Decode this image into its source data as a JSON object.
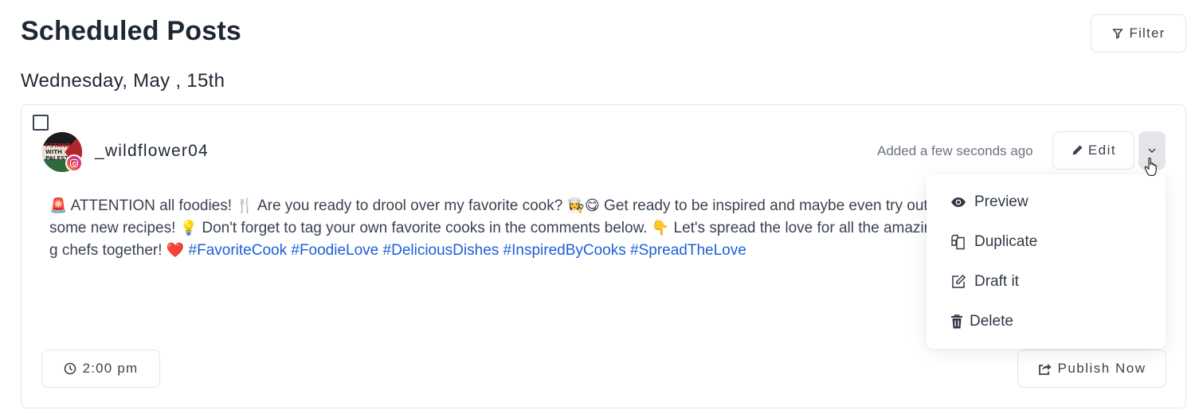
{
  "header": {
    "title": "Scheduled Posts",
    "filter_label": "Filter",
    "filter_icon": "filter-icon"
  },
  "date_heading": "Wednesday, May , 15th",
  "post": {
    "selected": false,
    "account": {
      "username": "_wildflower04",
      "avatar_text": [
        "I STAND",
        "WITH",
        "PALEST"
      ],
      "platform": "instagram",
      "platform_icon": "instagram-icon"
    },
    "added_text": "Added a few seconds ago",
    "edit_label": "Edit",
    "edit_icon": "pencil-icon",
    "more_icon": "chevron-down-icon",
    "content": {
      "segments": [
        {
          "type": "emoji",
          "text": "🚨",
          "name": "siren-emoji"
        },
        {
          "type": "text",
          "text": " ATTENTION all foodies! "
        },
        {
          "type": "emoji",
          "text": "🍴",
          "name": "fork-knife-emoji"
        },
        {
          "type": "text",
          "text": " Are you ready to drool over my favorite cook? "
        },
        {
          "type": "emoji",
          "text": "👩‍🍳",
          "name": "woman-cook-emoji"
        },
        {
          "type": "emoji",
          "text": "😋",
          "name": "yum-face-emoji"
        },
        {
          "type": "text",
          "text": " Get ready to be inspired and maybe even try out some new recipes! "
        },
        {
          "type": "emoji",
          "text": "💡",
          "name": "light-bulb-emoji"
        },
        {
          "type": "text",
          "text": " Don't forget to tag your own favorite cooks in the comments below. "
        },
        {
          "type": "emoji",
          "text": "👇",
          "name": "pointing-down-emoji"
        },
        {
          "type": "text",
          "text": " Let's spread the love for all the amazing chefs together! "
        },
        {
          "type": "emoji",
          "text": "❤️",
          "name": "red-heart-emoji"
        },
        {
          "type": "text",
          "text": " "
        }
      ],
      "hashtags": [
        "#FavoriteCook",
        "#FoodieLove",
        "#DeliciousDishes",
        "#InspiredByCooks",
        "#SpreadTheLove"
      ]
    },
    "time_label": "2:00 pm",
    "time_icon": "clock-icon",
    "publish_label": "Publish Now",
    "publish_icon": "share-icon"
  },
  "dropdown": {
    "open": true,
    "items": [
      {
        "label": "Preview",
        "icon": "eye-icon"
      },
      {
        "label": "Duplicate",
        "icon": "duplicate-icon"
      },
      {
        "label": "Draft it",
        "icon": "edit-square-icon"
      },
      {
        "label": "Delete",
        "icon": "trash-icon"
      }
    ]
  },
  "colors": {
    "hashtag": "#1d5fd6",
    "text": "#3a4350",
    "title": "#1f2733",
    "muted": "#6b7380",
    "border": "#e2e4e8"
  }
}
